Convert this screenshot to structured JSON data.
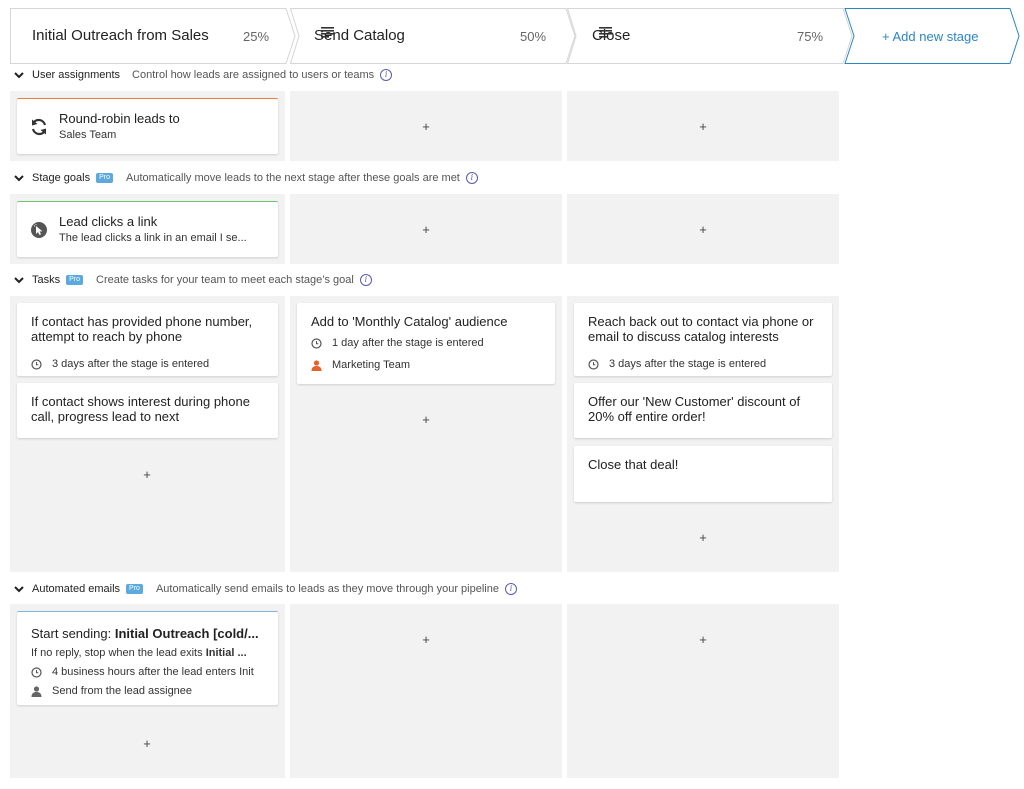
{
  "stages": [
    {
      "name": "Initial Outreach from Sales",
      "percent": "25%",
      "has_lines_icon": false
    },
    {
      "name": "Send Catalog",
      "percent": "50%",
      "has_lines_icon": true
    },
    {
      "name": "Close",
      "percent": "75%",
      "has_lines_icon": true
    }
  ],
  "add_stage_label": "+ Add new stage",
  "plus": "+",
  "sections": {
    "user_assignments": {
      "title": "User assignments",
      "desc": "Control how leads are assigned to users or teams",
      "pro": ""
    },
    "stage_goals": {
      "title": "Stage goals",
      "desc": "Automatically move leads to the next stage after these goals are met",
      "pro": "Pro"
    },
    "tasks": {
      "title": "Tasks",
      "desc": "Create tasks for your team to meet each stage’s goal",
      "pro": "Pro"
    },
    "emails": {
      "title": "Automated emails",
      "desc": "Automatically send emails to leads as they move through your pipeline",
      "pro": "Pro"
    }
  },
  "info_glyph": "i",
  "assignment_card": {
    "title": "Round-robin leads to",
    "subtitle": "Sales Team",
    "accent": "#e8803a"
  },
  "goal_card": {
    "title": "Lead clicks a link",
    "subtitle": "The lead clicks a link in an email I se...",
    "accent": "#6cc46c"
  },
  "tasks": {
    "col1": [
      {
        "title": "If contact has provided phone number, attempt to reach by phone",
        "timing": "3 days after the stage is entered"
      },
      {
        "title": "If contact shows interest during phone call, progress lead to next",
        "timing": ""
      }
    ],
    "col2": [
      {
        "title": "Add to 'Monthly Catalog' audience",
        "timing": "1 day after the stage is entered",
        "assignee": "Marketing Team"
      }
    ],
    "col3": [
      {
        "title": "Reach back out to contact via phone or email to discuss catalog interests",
        "timing": "3 days after the stage is entered"
      },
      {
        "title": "Offer our 'New Customer' discount of 20% off entire order!",
        "timing": ""
      },
      {
        "title": "Close that deal!",
        "timing": ""
      }
    ]
  },
  "email_card": {
    "title_prefix": "Start sending: ",
    "title_bold": "Initial Outreach [cold/...",
    "stop_prefix": "If no reply, stop when the lead exits ",
    "stop_bold": "Initial ...",
    "timing": "4 business hours after the lead enters Init",
    "sender": "Send from the lead assignee",
    "accent": "#7fb7e0"
  },
  "colors": {
    "accent_blue": "#2b86c8",
    "assignee_orange": "#e8602a",
    "column_bg": "#f2f2f2"
  }
}
